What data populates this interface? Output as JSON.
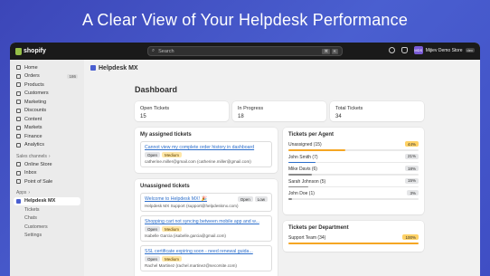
{
  "banner": {
    "title": "A Clear View of Your Helpdesk Performance"
  },
  "topbar": {
    "brand": "shopify",
    "search_placeholder": "Search",
    "shortcut": [
      "⌘",
      "K"
    ],
    "store_initials": "MDS",
    "store_name": "Mijiev Demo Store",
    "store_badge": "dev"
  },
  "sidebar": {
    "items": [
      {
        "label": "Home",
        "icon": "home-icon"
      },
      {
        "label": "Orders",
        "icon": "orders-icon",
        "count": "186"
      },
      {
        "label": "Products",
        "icon": "products-icon"
      },
      {
        "label": "Customers",
        "icon": "customers-icon"
      },
      {
        "label": "Marketing",
        "icon": "marketing-icon"
      },
      {
        "label": "Discounts",
        "icon": "discounts-icon"
      },
      {
        "label": "Content",
        "icon": "content-icon"
      },
      {
        "label": "Markets",
        "icon": "markets-icon"
      },
      {
        "label": "Finance",
        "icon": "finance-icon"
      },
      {
        "label": "Analytics",
        "icon": "analytics-icon"
      }
    ],
    "sales_label": "Sales channels",
    "sales_items": [
      {
        "label": "Online Store",
        "icon": "store-icon"
      },
      {
        "label": "Inbox",
        "icon": "inbox-icon"
      },
      {
        "label": "Point of Sale",
        "icon": "pos-icon"
      }
    ],
    "apps_label": "Apps",
    "app_active": "Helpdesk MX",
    "app_sub": [
      "Tickets",
      "Chats",
      "Customers",
      "Settings"
    ]
  },
  "main": {
    "app_title": "Helpdesk MX",
    "page_title": "Dashboard",
    "stats": [
      {
        "label": "Open Tickets",
        "value": "15"
      },
      {
        "label": "In Progress",
        "value": "18"
      },
      {
        "label": "Total Tickets",
        "value": "34"
      }
    ],
    "assigned": {
      "title": "My assigned tickets",
      "tickets": [
        {
          "title": "Cannot view my complete order history in dashboard",
          "status": "Open",
          "priority": "Medium",
          "meta": "catherine.miller@gmail.com (catherine.miller@gmail.com)"
        }
      ]
    },
    "unassigned": {
      "title": "Unassigned tickets",
      "tickets": [
        {
          "title": "Welcome to Helpdesk MX! 🎉",
          "status": "Open",
          "priority": "Low",
          "meta": "Helpdesk MX Support (support@helpdeskmx.com)"
        },
        {
          "title": "Shopping cart not syncing between mobile app and w...",
          "status": "Open",
          "priority": "Medium",
          "meta": "Isabelle Garcia (isabelle.garcia@gmail.com)"
        },
        {
          "title": "SSL certificate expiring soon - need renewal guida...",
          "status": "Open",
          "priority": "Medium",
          "meta": "Rachel Martinez (rachel.martinez@secorsite.com)"
        }
      ]
    },
    "per_agent": {
      "title": "Tickets per Agent",
      "rows": [
        {
          "name": "Unassigned (15)",
          "pct": "44%",
          "value": 44,
          "color": "#f5a623",
          "hi": true
        },
        {
          "name": "John Smith (7)",
          "pct": "21%",
          "value": 21,
          "color": "#2c6ecb",
          "hi": false
        },
        {
          "name": "Mike Davis (6)",
          "pct": "18%",
          "value": 18,
          "color": "#8a8a8a",
          "hi": false
        },
        {
          "name": "Sarah Johnson (5)",
          "pct": "15%",
          "value": 15,
          "color": "#8a8a8a",
          "hi": false
        },
        {
          "name": "John Doe (1)",
          "pct": "3%",
          "value": 3,
          "color": "#8a8a8a",
          "hi": false
        }
      ]
    },
    "per_department": {
      "title": "Tickets per Department",
      "rows": [
        {
          "name": "Support Team (34)",
          "pct": "100%",
          "value": 100,
          "color": "#f5a623",
          "hi": true
        }
      ]
    }
  }
}
